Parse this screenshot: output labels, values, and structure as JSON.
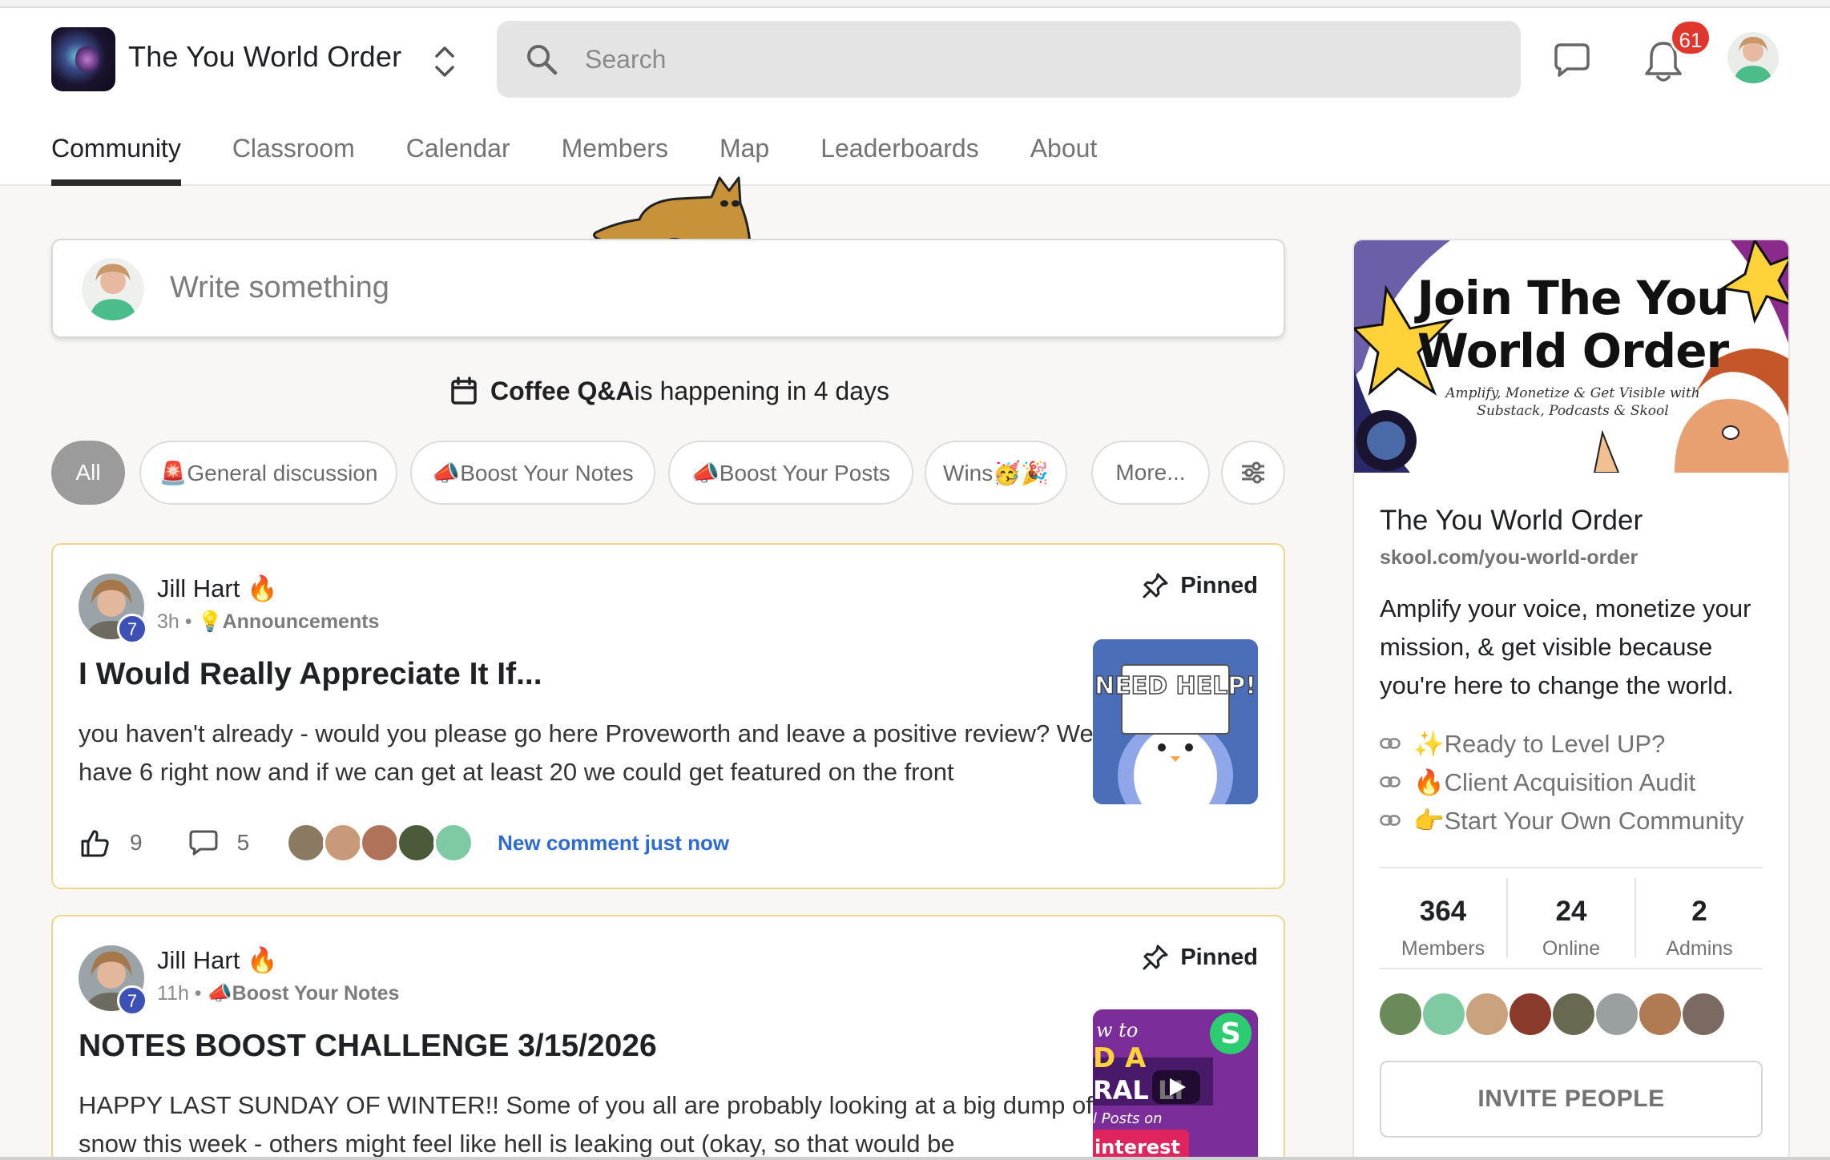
{
  "header": {
    "group_name": "The You World Order",
    "search_placeholder": "Search",
    "notification_count": "61"
  },
  "tabs": [
    {
      "label": "Community",
      "active": true
    },
    {
      "label": "Classroom"
    },
    {
      "label": "Calendar"
    },
    {
      "label": "Members"
    },
    {
      "label": "Map"
    },
    {
      "label": "Leaderboards"
    },
    {
      "label": "About"
    }
  ],
  "composer": {
    "placeholder": "Write something"
  },
  "event": {
    "name": "Coffee Q&A",
    "text": " is happening in 4 days"
  },
  "filters": [
    {
      "label": "All",
      "active": true
    },
    {
      "label": "🚨General discussion"
    },
    {
      "label": "📣Boost Your Notes"
    },
    {
      "label": "📣Boost Your Posts"
    },
    {
      "label": "Wins🥳🎉"
    },
    {
      "label": "More..."
    }
  ],
  "posts": [
    {
      "author": "Jill Hart",
      "author_emoji": "🔥",
      "level": "7",
      "time": "3h",
      "category": "💡Announcements",
      "pinned_label": "Pinned",
      "title": "I Would Really Appreciate It If...",
      "body": "you haven't already - would you please go here Proveworth and leave a positive review? We have 6 right now and if we can get at least 20 we could get featured on the front",
      "likes": "9",
      "comments": "5",
      "new_comment": "New comment just now",
      "thumb_text": "NEED HELP!"
    },
    {
      "author": "Jill Hart",
      "author_emoji": "🔥",
      "level": "7",
      "time": "11h",
      "category": "📣Boost Your Notes",
      "pinned_label": "Pinned",
      "title": "NOTES BOOST CHALLENGE 3/15/2026",
      "body": "HAPPY LAST SUNDAY OF WINTER!! Some of you all are probably looking at a big dump of snow this week - others might feel like hell is leaking out (okay, so that would be",
      "thumb_text": "w to D A RAL LI l Posts on Pinterest"
    }
  ],
  "sidebar": {
    "banner_title_1": "Join The You",
    "banner_title_2": "World Order",
    "banner_sub_1": "Amplify, Monetize & Get Visible with",
    "banner_sub_2": "Substack, Podcasts & Skool",
    "name": "The You World Order",
    "url": "skool.com/you-world-order",
    "description": "Amplify your voice, monetize your mission, & get visible because you're here to change the world.",
    "links": [
      "✨Ready to Level UP?",
      "🔥Client Acquisition Audit",
      "👉Start Your Own Community"
    ],
    "stats": [
      {
        "value": "364",
        "label": "Members"
      },
      {
        "value": "24",
        "label": "Online"
      },
      {
        "value": "2",
        "label": "Admins"
      }
    ],
    "invite_label": "INVITE PEOPLE"
  }
}
